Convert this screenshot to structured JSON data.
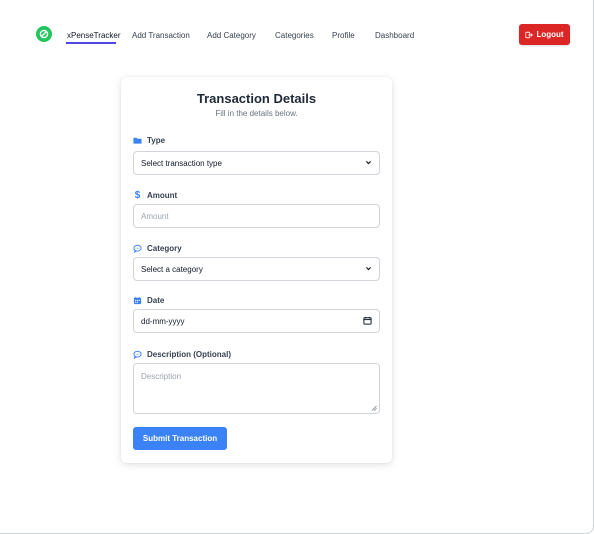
{
  "nav": {
    "logo_icon": "link-icon",
    "items": [
      {
        "label": "xPenseTracker",
        "active": true
      },
      {
        "label": "Add Transaction",
        "active": false
      },
      {
        "label": "Add Category",
        "active": false
      },
      {
        "label": "Categories",
        "active": false
      },
      {
        "label": "Profile",
        "active": false
      },
      {
        "label": "Dashboard",
        "active": false
      }
    ],
    "logout_label": "Logout",
    "logout_icon": "logout-icon"
  },
  "form": {
    "title": "Transaction Details",
    "subtitle": "Fill in the details below.",
    "type": {
      "label": "Type",
      "icon": "folder-icon",
      "selected": "Select transaction type"
    },
    "amount": {
      "label": "Amount",
      "icon": "dollar-icon",
      "placeholder": "Amount"
    },
    "category": {
      "label": "Category",
      "icon": "chat-icon",
      "selected": "Select a category"
    },
    "date": {
      "label": "Date",
      "icon": "calendar-icon",
      "value": "dd-mm-yyyy"
    },
    "description": {
      "label": "Description (Optional)",
      "icon": "chat-icon",
      "placeholder": "Description"
    },
    "submit_label": "Submit Transaction"
  },
  "colors": {
    "accent": "#3b82f6",
    "danger": "#dc2626",
    "logo": "#22c55e",
    "nav_underline": "#4f46e5"
  }
}
